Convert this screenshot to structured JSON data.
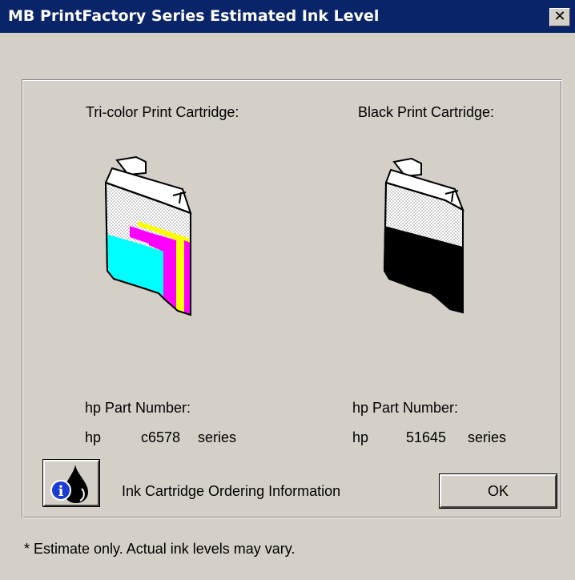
{
  "window": {
    "title": "MB PrintFactory Series Estimated Ink Level",
    "close_glyph": "✕"
  },
  "tricolor": {
    "heading": "Tri-color Print Cartridge:",
    "part_label": "hp Part Number:",
    "brand": "hp",
    "part_number": "c6578",
    "suffix": "series",
    "icon": "tricolor-cartridge-icon",
    "colors": {
      "cyan": "#00ffff",
      "magenta": "#ff00ff",
      "yellow": "#ffff00"
    }
  },
  "black": {
    "heading": "Black Print Cartridge:",
    "part_label": "hp Part Number:",
    "brand": "hp",
    "part_number": "51645",
    "suffix": "series",
    "icon": "black-cartridge-icon",
    "colors": {
      "ink": "#000000"
    }
  },
  "ordering": {
    "label": "Ink Cartridge Ordering Information",
    "icon": "ink-drop-info-icon"
  },
  "ok_label": "OK",
  "footnote": "* Estimate only. Actual ink levels may vary.",
  "colors": {
    "titlebar": "#0a246a",
    "face": "#d4d0c8"
  }
}
